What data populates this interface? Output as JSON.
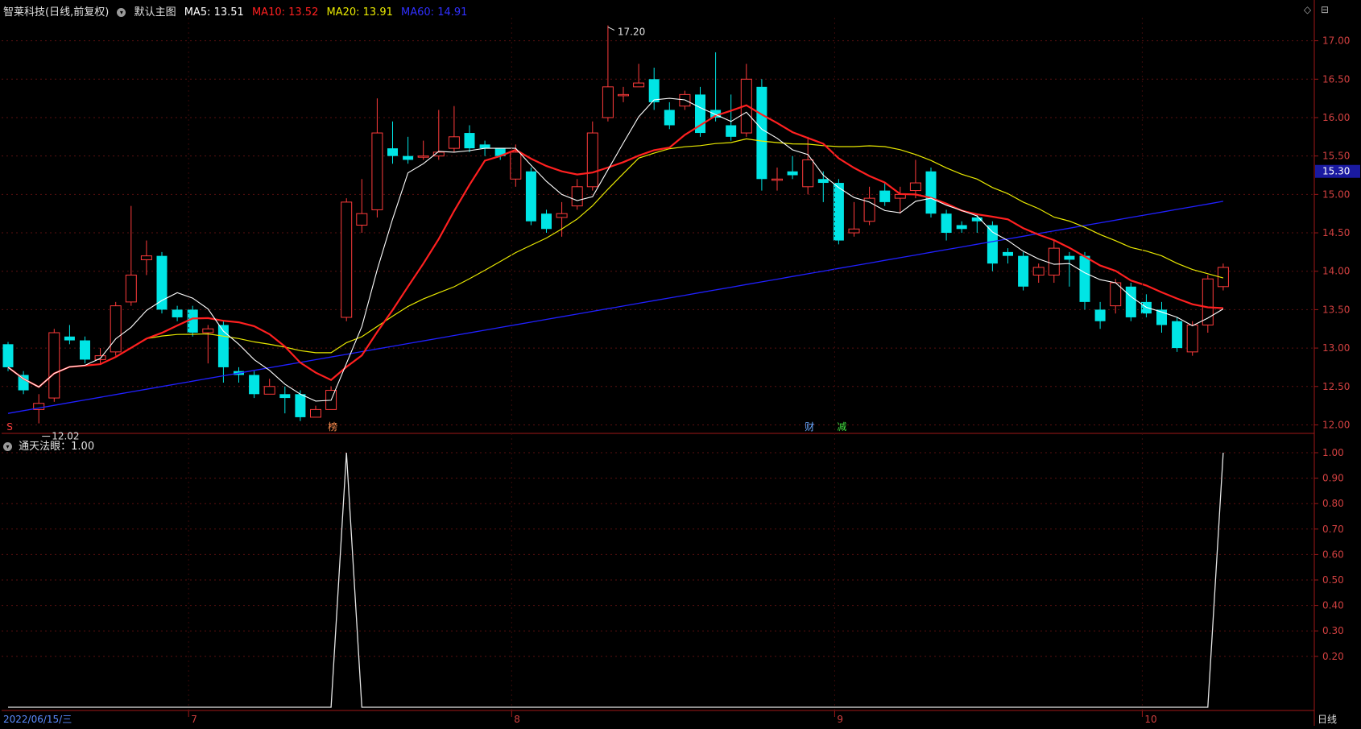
{
  "header": {
    "stock": "智莱科技(日线,前复权)",
    "chart_name": "默认主图",
    "ma5": "MA5: 13.51",
    "ma10": "MA10: 13.52",
    "ma20": "MA20: 13.91",
    "ma60": "MA60: 14.91",
    "colors": {
      "ma5": "#ffffff",
      "ma10": "#ff2020",
      "ma20": "#e8e800",
      "ma60": "#2020ff"
    }
  },
  "sub_header": {
    "indicator": "通天法眼：1.00"
  },
  "toolbar_icons": [
    "diamond-icon",
    "maximize-icon"
  ],
  "price_axis": {
    "ticks": [
      "17.00",
      "16.50",
      "16.00",
      "15.50",
      "15.00",
      "14.50",
      "14.00",
      "13.50",
      "13.00",
      "12.50",
      "12.00"
    ],
    "current_price": "15.30"
  },
  "indicator_axis": {
    "ticks": [
      "1.00",
      "0.90",
      "0.80",
      "0.70",
      "0.60",
      "0.50",
      "0.40",
      "0.30",
      "0.20"
    ]
  },
  "time_axis": {
    "start_date": "2022/06/15/三",
    "months": [
      "7",
      "8",
      "9",
      "10"
    ],
    "period": "日线"
  },
  "annotations": {
    "high": "17.20",
    "low": "12.02",
    "markers": [
      "S",
      "榜",
      "财",
      "减"
    ]
  },
  "chart_data": {
    "type": "candlestick",
    "ylim": [
      11.9,
      17.3
    ],
    "candles": [
      [
        13.05,
        12.75,
        13.08,
        12.7
      ],
      [
        12.65,
        12.45,
        12.7,
        12.4
      ],
      [
        12.2,
        12.28,
        12.4,
        12.02
      ],
      [
        12.35,
        13.2,
        13.25,
        12.3
      ],
      [
        13.15,
        13.1,
        13.3,
        13.05
      ],
      [
        13.1,
        12.85,
        13.15,
        12.8
      ],
      [
        12.85,
        12.9,
        13.0,
        12.8
      ],
      [
        12.95,
        13.55,
        13.6,
        12.9
      ],
      [
        13.6,
        13.95,
        14.85,
        13.55
      ],
      [
        14.15,
        14.2,
        14.4,
        13.95
      ],
      [
        14.2,
        13.5,
        14.25,
        13.45
      ],
      [
        13.5,
        13.4,
        13.55,
        13.35
      ],
      [
        13.5,
        13.2,
        13.55,
        13.15
      ],
      [
        13.2,
        13.25,
        13.3,
        12.8
      ],
      [
        13.3,
        12.75,
        13.35,
        12.55
      ],
      [
        12.7,
        12.65,
        12.75,
        12.55
      ],
      [
        12.65,
        12.4,
        12.7,
        12.35
      ],
      [
        12.4,
        12.5,
        12.6,
        12.4
      ],
      [
        12.4,
        12.35,
        12.5,
        12.15
      ],
      [
        12.4,
        12.1,
        12.45,
        12.05
      ],
      [
        12.1,
        12.2,
        12.25,
        12.1
      ],
      [
        12.2,
        12.45,
        12.5,
        12.2
      ],
      [
        13.4,
        14.9,
        14.95,
        13.35
      ],
      [
        14.6,
        14.75,
        15.2,
        14.5
      ],
      [
        14.8,
        15.8,
        16.25,
        14.7
      ],
      [
        15.6,
        15.5,
        15.95,
        15.4
      ],
      [
        15.5,
        15.45,
        15.75,
        15.4
      ],
      [
        15.5,
        15.5,
        15.7,
        15.45
      ],
      [
        15.5,
        15.55,
        16.1,
        15.45
      ],
      [
        15.6,
        15.75,
        16.15,
        15.55
      ],
      [
        15.8,
        15.6,
        15.9,
        15.55
      ],
      [
        15.65,
        15.6,
        15.7,
        15.5
      ],
      [
        15.6,
        15.5,
        15.6,
        15.45
      ],
      [
        15.2,
        15.55,
        15.65,
        15.1
      ],
      [
        15.3,
        14.65,
        15.35,
        14.6
      ],
      [
        14.75,
        14.55,
        14.8,
        14.5
      ],
      [
        14.7,
        14.75,
        14.9,
        14.45
      ],
      [
        14.85,
        15.1,
        15.2,
        14.8
      ],
      [
        15.1,
        15.8,
        15.95,
        15.05
      ],
      [
        16.0,
        16.4,
        17.2,
        15.95
      ],
      [
        16.3,
        16.3,
        16.4,
        16.2
      ],
      [
        16.4,
        16.45,
        16.7,
        16.4
      ],
      [
        16.5,
        16.2,
        16.65,
        16.1
      ],
      [
        16.1,
        15.9,
        16.2,
        15.85
      ],
      [
        16.15,
        16.3,
        16.35,
        16.1
      ],
      [
        16.3,
        15.8,
        16.4,
        15.75
      ],
      [
        16.1,
        16.0,
        16.85,
        15.95
      ],
      [
        15.9,
        15.75,
        16.3,
        15.7
      ],
      [
        15.8,
        16.5,
        16.7,
        15.75
      ],
      [
        16.4,
        15.2,
        16.5,
        15.05
      ],
      [
        15.2,
        15.2,
        15.35,
        15.05
      ],
      [
        15.3,
        15.25,
        15.5,
        15.2
      ],
      [
        15.1,
        15.45,
        15.75,
        15.0
      ],
      [
        15.2,
        15.15,
        15.3,
        14.9
      ],
      [
        15.15,
        14.4,
        15.2,
        14.35
      ],
      [
        14.5,
        14.55,
        14.9,
        14.45
      ],
      [
        14.65,
        14.95,
        15.1,
        14.6
      ],
      [
        15.05,
        14.9,
        15.15,
        14.85
      ],
      [
        14.95,
        15.0,
        15.1,
        14.75
      ],
      [
        15.05,
        15.15,
        15.45,
        14.95
      ],
      [
        15.3,
        14.75,
        15.35,
        14.7
      ],
      [
        14.75,
        14.5,
        14.8,
        14.4
      ],
      [
        14.6,
        14.55,
        14.65,
        14.5
      ],
      [
        14.7,
        14.65,
        14.75,
        14.5
      ],
      [
        14.6,
        14.1,
        14.65,
        14.0
      ],
      [
        14.25,
        14.2,
        14.3,
        14.1
      ],
      [
        14.2,
        13.8,
        14.25,
        13.75
      ],
      [
        13.95,
        14.05,
        14.1,
        13.85
      ],
      [
        13.95,
        14.3,
        14.4,
        13.85
      ],
      [
        14.2,
        14.15,
        14.25,
        13.8
      ],
      [
        14.2,
        13.6,
        14.25,
        13.5
      ],
      [
        13.5,
        13.35,
        13.6,
        13.25
      ],
      [
        13.55,
        13.85,
        13.9,
        13.45
      ],
      [
        13.8,
        13.4,
        13.85,
        13.35
      ],
      [
        13.6,
        13.45,
        13.7,
        13.4
      ],
      [
        13.5,
        13.3,
        13.6,
        13.2
      ],
      [
        13.35,
        13.0,
        13.4,
        12.95
      ],
      [
        12.95,
        13.3,
        13.35,
        12.9
      ],
      [
        13.3,
        13.9,
        13.95,
        13.2
      ],
      [
        13.8,
        14.05,
        14.1,
        13.75
      ]
    ],
    "indicator": {
      "name": "通天法眼",
      "values_spikes": [
        [
          22,
          1.0
        ],
        [
          79,
          1.0
        ]
      ]
    }
  }
}
